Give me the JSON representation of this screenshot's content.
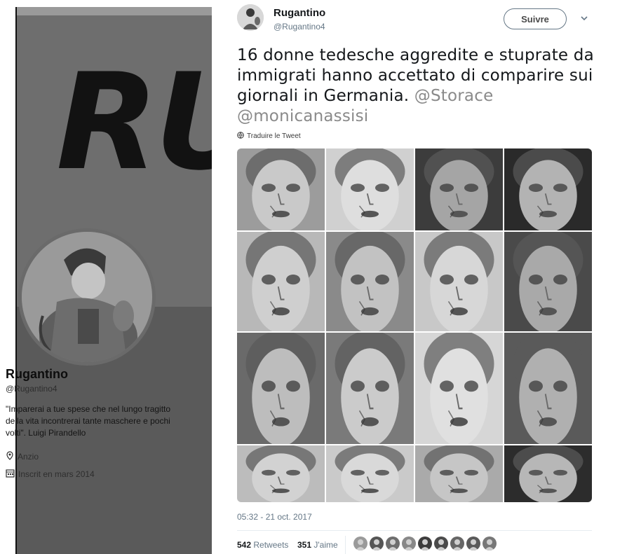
{
  "profile": {
    "banner_text": "RU",
    "name": "Rugantino",
    "handle": "@Rugantino4",
    "bio": "\"Imparerai a tue spese che nel lungo tragitto della vita incontrerai tante maschere e pochi volti\". Luigi Pirandello",
    "location": "Anzio",
    "joined": "Inscrit en mars 2014"
  },
  "tweet": {
    "display_name": "Rugantino",
    "screen_name": "@Rugantino4",
    "follow_label": "Suivre",
    "text": "16 donne tedesche aggredite e stuprate da immigrati hanno accettato di comparire sui giornali in Germania.",
    "mentions": [
      "@Storace",
      "@monicanassisi"
    ],
    "translate_label": "Traduire le Tweet",
    "photo_count": 16,
    "timestamp": "05:32 - 21 oct. 2017",
    "retweets": {
      "count": "542",
      "label": "Retweets"
    },
    "likes": {
      "count": "351",
      "label": "J'aime"
    },
    "liker_count": 9
  },
  "colors": {
    "text": "#14171a",
    "secondary": "#657786",
    "mention": "#8a8a8a",
    "panel": "#5c5c5c"
  },
  "icons": [
    "location-pin-icon",
    "calendar-icon",
    "globe-icon",
    "chevron-down-icon"
  ]
}
